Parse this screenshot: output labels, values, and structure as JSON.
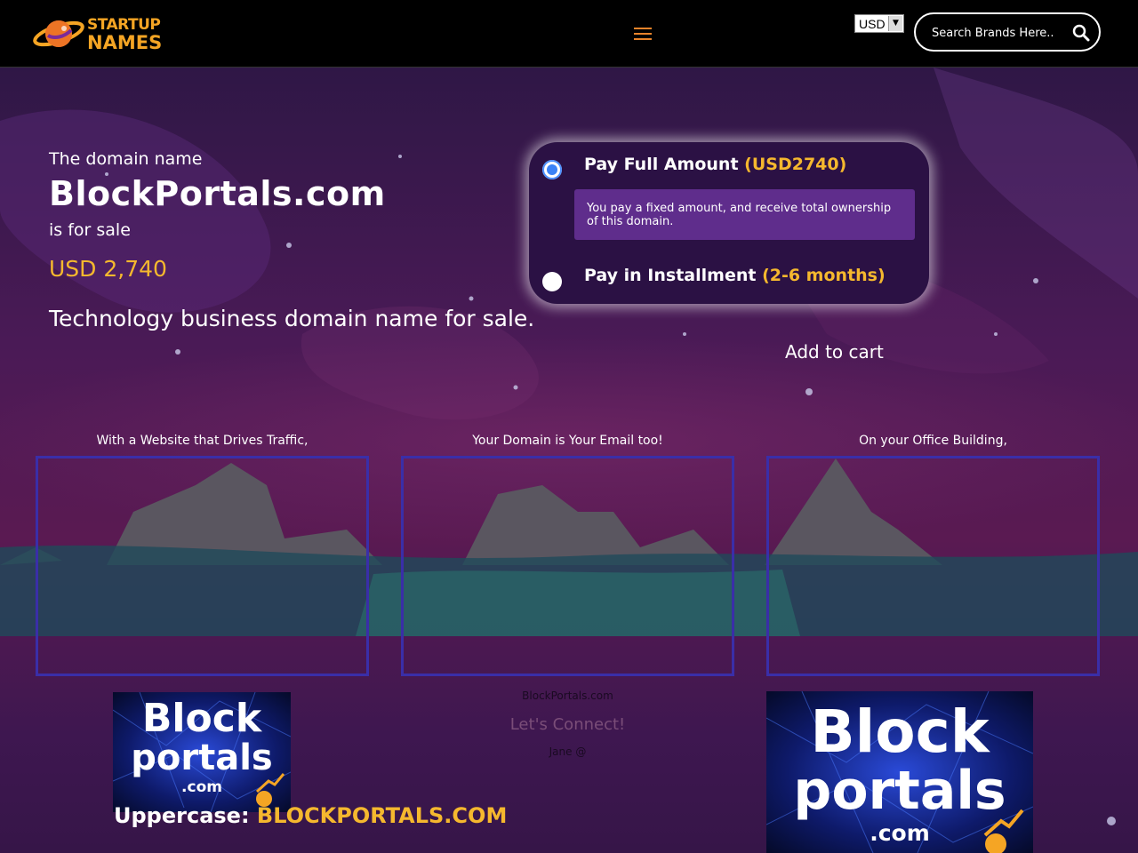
{
  "header": {
    "logo_line1": "STARTUP",
    "logo_line2": "NAMES",
    "currency": "USD",
    "search_placeholder": "Search Brands Here.."
  },
  "hero": {
    "label": "The domain name",
    "domain": "BlockPortals.com",
    "for_sale": "is for sale",
    "price": "USD 2,740",
    "tagline": "Technology business domain name for sale."
  },
  "payment": {
    "option1_label": "Pay Full Amount",
    "option1_amount": "(USD2740)",
    "option1_desc": "You pay a fixed amount, and receive total ownership of this domain.",
    "option2_label": "Pay in Installment",
    "option2_amount": "(2-6 months)",
    "add_to_cart": "Add to cart"
  },
  "showcase": {
    "captions": [
      "With a Website that Drives Traffic,",
      "Your Domain is Your Email too!",
      "On your Office Building,"
    ],
    "mid_domain": "BlockPortals.com",
    "mid_connect": "Let's Connect!",
    "mid_jane": "Jane @"
  },
  "logo_image": {
    "line1": "Block",
    "line2": "portals",
    "line3": ".com"
  },
  "uppercase": {
    "label": "Uppercase:",
    "value": "BLOCKPORTALS.COM"
  },
  "colors": {
    "accent": "#f5b82e",
    "header_bg": "#000000",
    "card_bg": "#2b1144",
    "desc_bg": "#5f2d8c",
    "frame_border": "#3a2ea8"
  }
}
